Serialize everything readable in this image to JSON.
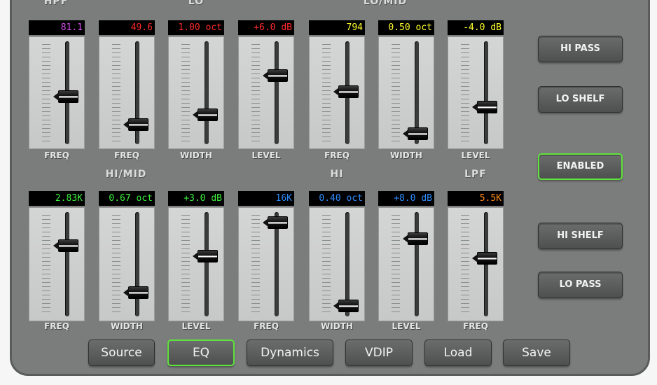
{
  "groups": {
    "hpf": "HPF",
    "lo": "LO",
    "lo_mid": "LO/MID",
    "hi_mid": "HI/MID",
    "hi": "HI",
    "lpf": "LPF"
  },
  "strips": [
    {
      "id": "hpf-freq",
      "readout": "81.1",
      "color": "#d94cf0",
      "label": "FREQ",
      "level": 0.46
    },
    {
      "id": "lo-freq",
      "readout": "49.6",
      "color": "#ff2b2b",
      "label": "FREQ",
      "level": 0.14
    },
    {
      "id": "lo-width",
      "readout": "1.00 oct",
      "color": "#ff2b2b",
      "label": "WIDTH",
      "level": 0.25
    },
    {
      "id": "lo-level",
      "readout": "+6.0 dB",
      "color": "#ff2b2b",
      "label": "LEVEL",
      "level": 0.7
    },
    {
      "id": "lomid-freq",
      "readout": "794",
      "color": "#ffff2e",
      "label": "FREQ",
      "level": 0.51
    },
    {
      "id": "lomid-width",
      "readout": "0.50 oct",
      "color": "#ffff2e",
      "label": "WIDTH",
      "level": 0.03
    },
    {
      "id": "lomid-level",
      "readout": "-4.0 dB",
      "color": "#ffff2e",
      "label": "LEVEL",
      "level": 0.34
    },
    {
      "id": "himid-freq",
      "readout": "2.83K",
      "color": "#3cf03c",
      "label": "FREQ",
      "level": 0.71
    },
    {
      "id": "himid-width",
      "readout": "0.67 oct",
      "color": "#3cf03c",
      "label": "WIDTH",
      "level": 0.18
    },
    {
      "id": "himid-level",
      "readout": "+3.0 dB",
      "color": "#3cf03c",
      "label": "LEVEL",
      "level": 0.59
    },
    {
      "id": "hi-freq",
      "readout": "16K",
      "color": "#2e8cff",
      "label": "FREQ",
      "level": 0.97
    },
    {
      "id": "hi-width",
      "readout": "0.40 oct",
      "color": "#2e8cff",
      "label": "WIDTH",
      "level": 0.03
    },
    {
      "id": "hi-level",
      "readout": "+8.0 dB",
      "color": "#2e8cff",
      "label": "LEVEL",
      "level": 0.79
    },
    {
      "id": "lpf-freq",
      "readout": "5.5K",
      "color": "#ff8a1c",
      "label": "FREQ",
      "level": 0.57
    }
  ],
  "side_buttons": {
    "hi_pass": "HI PASS",
    "lo_shelf": "LO SHELF",
    "enabled": "ENABLED",
    "hi_shelf": "HI SHELF",
    "lo_pass": "LO PASS"
  },
  "nav": {
    "source": "Source",
    "eq": "EQ",
    "dynamics": "Dynamics",
    "vdip": "VDIP",
    "load": "Load",
    "save": "Save",
    "active": "EQ"
  },
  "colors": {
    "panel": "#7b7d7d",
    "active_outline": "#5ee33c"
  }
}
